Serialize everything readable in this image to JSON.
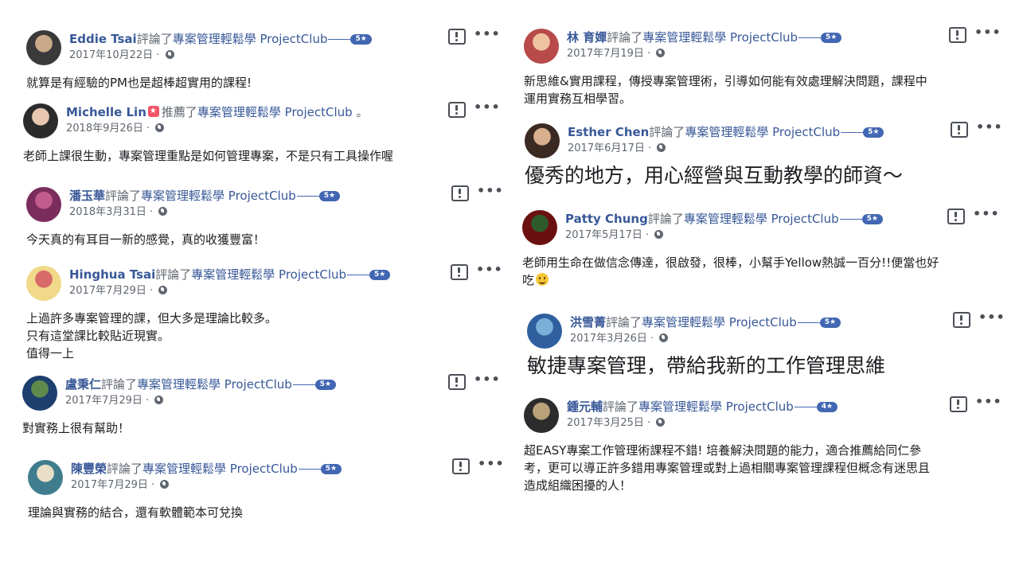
{
  "common": {
    "action_review": "評論了",
    "page_name": "專案管理輕鬆學 ProjectClub",
    "more": "•••"
  },
  "colors": {
    "name": "#385898",
    "rating_badge": "#4267b2",
    "meta": "#606770"
  },
  "reviews": [
    {
      "name": "Eddie Tsai",
      "action": "評論了",
      "suffix": "",
      "rating": "5★",
      "date": "2017年10月22日 · ",
      "text": [
        "就算是有經驗的PM也是超棒超實用的課程!"
      ]
    },
    {
      "name": "Michelle Lin",
      "action": "推薦了",
      "suffix": " 。",
      "rating": "",
      "date": "2018年9月26日 · ",
      "text": [
        "老師上課很生動，專案管理重點是如何管理專案，不是只有工具操作喔"
      ]
    },
    {
      "name": "潘玉華",
      "action": "評論了",
      "suffix": "",
      "rating": "5★",
      "date": "2018年3月31日 · ",
      "text": [
        "今天真的有耳目一新的感覺，真的收獲豐富！"
      ]
    },
    {
      "name": "Hinghua Tsai",
      "action": "評論了",
      "suffix": "",
      "rating": "5★",
      "date": "2017年7月29日 · ",
      "text": [
        "上過許多專案管理的課，但大多是理論比較多。",
        "只有這堂課比較貼近現實。",
        "值得一上"
      ]
    },
    {
      "name": "盧秉仁",
      "action": "評論了",
      "suffix": "",
      "rating": "5★",
      "date": "2017年7月29日 · ",
      "text": [
        "對實務上很有幫助！"
      ]
    },
    {
      "name": "陳豐榮",
      "action": "評論了",
      "suffix": "",
      "rating": "5★",
      "date": "2017年7月29日 · ",
      "text": [
        "理論與實務的結合，還有軟體範本可兌換"
      ]
    },
    {
      "name": "林 育嬋",
      "action": "評論了",
      "suffix": "",
      "rating": "5★",
      "date": "2017年7月19日 · ",
      "text": [
        "新思維&實用課程，傳授專案管理術，引導如何能有效處理解決問題，課程中",
        "運用實務互相學習。"
      ]
    },
    {
      "name": "Esther Chen",
      "action": "評論了",
      "suffix": "",
      "rating": "5★",
      "date": "2017年6月17日 · ",
      "text": [
        "優秀的地方，用心經營與互動教學的師資～"
      ]
    },
    {
      "name": "Patty Chung",
      "action": "評論了",
      "suffix": "",
      "rating": "5★",
      "date": "2017年5月17日 · ",
      "text": [
        "老師用生命在做信念傳達，很啟發，很棒，小幫手Yellow熱誠一百分!!便當也好",
        "吃"
      ]
    },
    {
      "name": "洪雪菁",
      "action": "評論了",
      "suffix": "",
      "rating": "5★",
      "date": "2017年3月26日 · ",
      "text": [
        "敏捷專案管理，帶給我新的工作管理思維"
      ]
    },
    {
      "name": "鍾元輔",
      "action": "評論了",
      "suffix": "",
      "rating": "4★",
      "date": "2017年3月25日 · ",
      "text": [
        "超EASY專案工作管理術課程不錯! 培養解決問題的能力，適合推薦給同仁參",
        "考，更可以導正許多錯用專案管理或對上過相關專案管理課程但概念有迷思且",
        "造成組織困擾的人！"
      ]
    }
  ]
}
